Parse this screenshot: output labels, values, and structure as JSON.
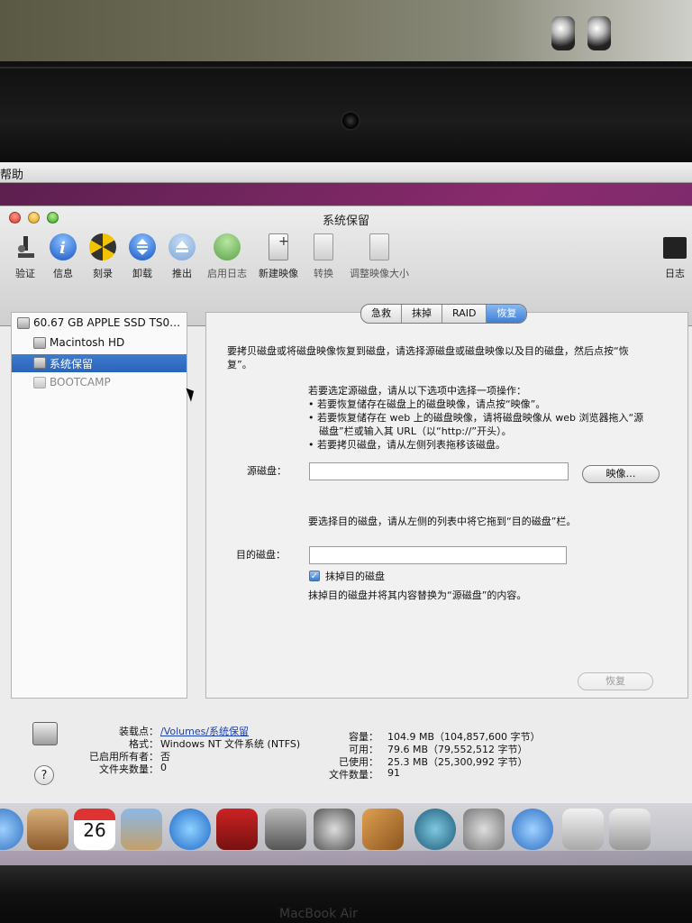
{
  "menubar": {
    "help": "帮助"
  },
  "window": {
    "title": "系统保留"
  },
  "toolbar": {
    "items": [
      {
        "label": "验证",
        "icon": "microscope-icon"
      },
      {
        "label": "信息",
        "icon": "info-icon"
      },
      {
        "label": "刻录",
        "icon": "burn-icon"
      },
      {
        "label": "卸载",
        "icon": "unmount-icon"
      },
      {
        "label": "推出",
        "icon": "eject-icon"
      },
      {
        "label": "启用日志",
        "icon": "enable-journaling-icon"
      },
      {
        "label": "新建映像",
        "icon": "new-image-icon"
      },
      {
        "label": "转换",
        "icon": "convert-icon"
      },
      {
        "label": "调整映像大小",
        "icon": "resize-image-icon"
      },
      {
        "label": "日志",
        "icon": "log-icon"
      }
    ]
  },
  "sidebar": {
    "items": [
      {
        "label": "60.67 GB APPLE SSD TS0…"
      },
      {
        "label": "Macintosh HD"
      },
      {
        "label": "系统保留"
      },
      {
        "label": "BOOTCAMP"
      }
    ]
  },
  "tabs": [
    "急救",
    "抹掉",
    "RAID",
    "恢复"
  ],
  "restore": {
    "intro_1": "要拷贝磁盘或将磁盘映像恢复到磁盘，请选择源磁盘或磁盘映像以及目的磁盘，然后点按“恢",
    "intro_2": "复”。",
    "opt_head": "若要选定源磁盘，请从以下选项中选择一项操作：",
    "opt_1": "• 若要恢复储存在磁盘上的磁盘映像，请点按“映像”。",
    "opt_2a": "• 若要恢复储存在 web 上的磁盘映像，请将磁盘映像从 web 浏览器拖入“源",
    "opt_2b": "磁盘”栏或输入其 URL（以“http://”开头）。",
    "opt_3": "• 若要拷贝磁盘，请从左侧列表拖移该磁盘。",
    "source_label": "源磁盘：",
    "source_value": "",
    "image_button": "映像…",
    "dest_hint": "要选择目的磁盘，请从左侧的列表中将它拖到“目的磁盘”栏。",
    "dest_label": "目的磁盘：",
    "dest_value": "",
    "erase_checkbox": "抹掉目的磁盘",
    "erase_checked": true,
    "erase_hint": "抹掉目的磁盘并将其内容替换为“源磁盘”的内容。",
    "restore_button": "恢复"
  },
  "info": {
    "mount_point_label": "装载点：",
    "mount_point": "/Volumes/系统保留",
    "format_label": "格式：",
    "format": "Windows NT 文件系统 (NTFS)",
    "owners_label": "已启用所有者：",
    "owners": "否",
    "folders_label": "文件夹数量：",
    "folders": "0",
    "capacity_label": "容量：",
    "capacity": "104.9 MB（104,857,600 字节）",
    "available_label": "可用：",
    "available": "79.6 MB（79,552,512 字节）",
    "used_label": "已使用：",
    "used": "25.3 MB（25,300,992 字节）",
    "files_label": "文件数量：",
    "files": "91"
  },
  "dock": {
    "calendar_day": "26",
    "items": [
      "finder-icon",
      "contacts-icon",
      "calendar-icon",
      "iphoto-icon",
      "itunes-icon",
      "photo-booth-icon",
      "image-capture-icon",
      "imovie-icon",
      "garageband-icon",
      "time-machine-icon",
      "system-preferences-icon",
      "sync-icon",
      "boot-camp-icon",
      "disk-utility-icon"
    ]
  },
  "bezel": {
    "brand": "MacBook Air"
  }
}
